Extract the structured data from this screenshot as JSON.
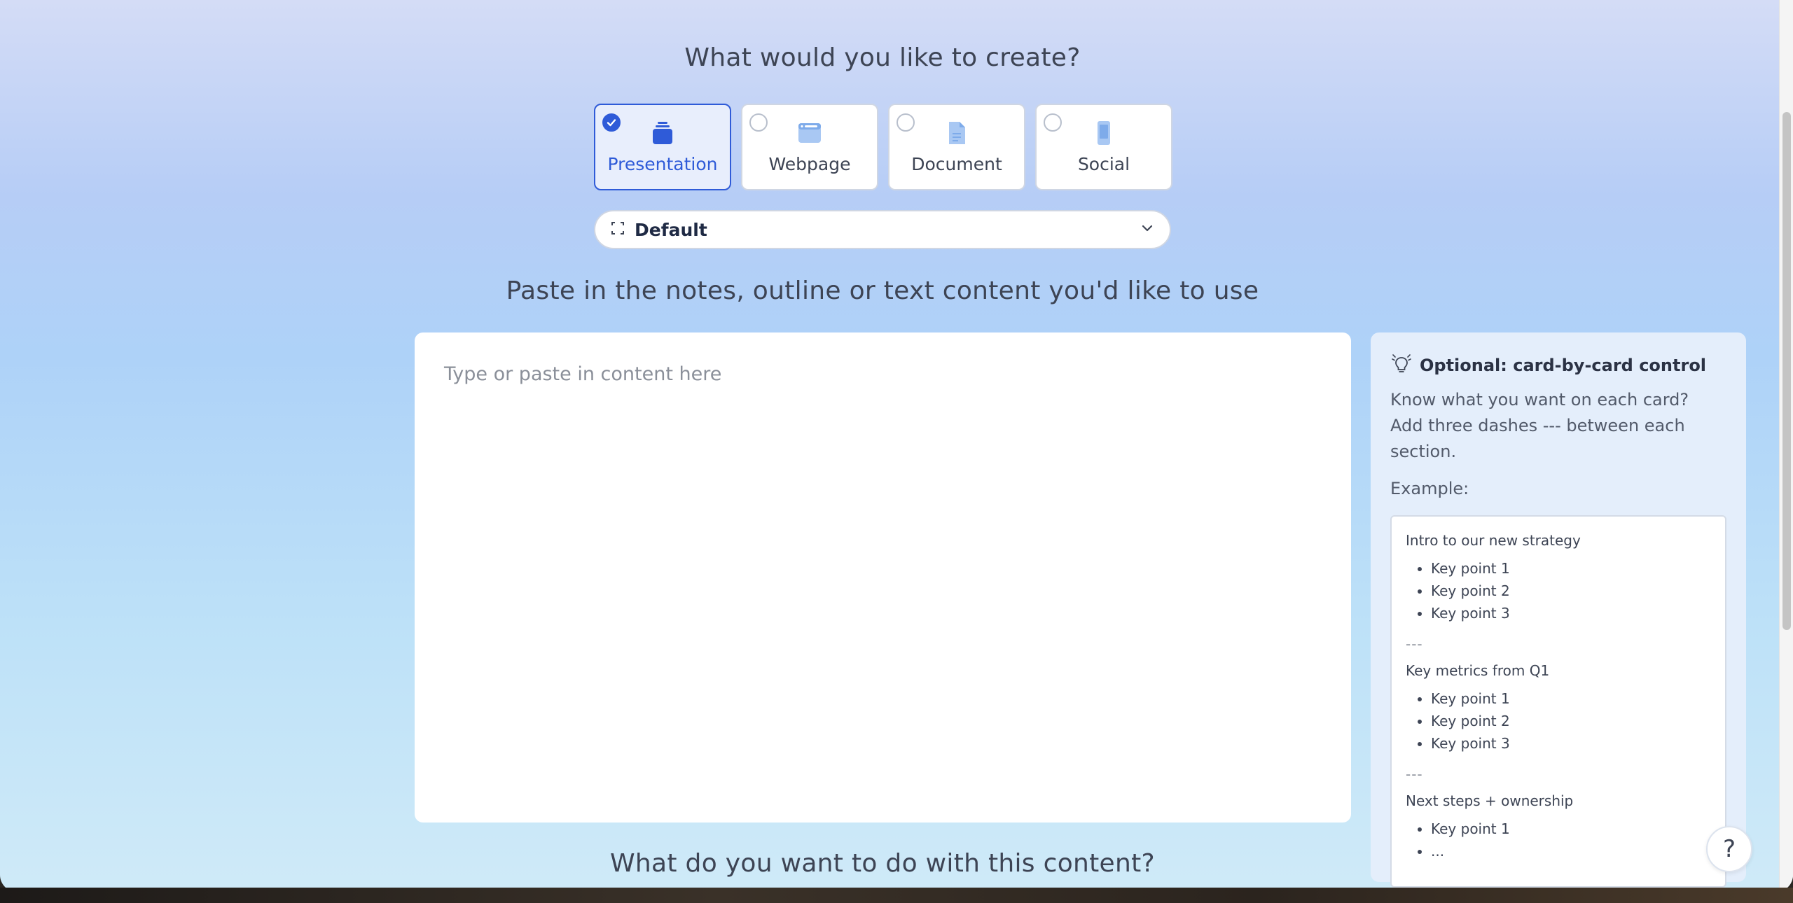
{
  "header": {
    "title": "What would you like to create?"
  },
  "types": [
    {
      "label": "Presentation",
      "selected": true,
      "icon": "stack-cards-icon"
    },
    {
      "label": "Webpage",
      "selected": false,
      "icon": "browser-window-icon"
    },
    {
      "label": "Document",
      "selected": false,
      "icon": "document-icon"
    },
    {
      "label": "Social",
      "selected": false,
      "icon": "phone-icon"
    }
  ],
  "theme": {
    "label": "Default",
    "icon": "aspect-ratio-icon"
  },
  "content": {
    "title": "Paste in the notes, outline or text content you'd like to use",
    "placeholder": "Type or paste in content here",
    "value": ""
  },
  "tip": {
    "title": "Optional: card-by-card control",
    "description": "Know what you want on each card? Add three dashes --- between each section.",
    "example_label": "Example:",
    "example": {
      "section1_title": "Intro to our new strategy",
      "section1_points": [
        "Key point 1",
        "Key point 2",
        "Key point 3"
      ],
      "separator": "---",
      "section2_title": "Key metrics from Q1",
      "section2_points": [
        "Key point 1",
        "Key point 2",
        "Key point 3"
      ],
      "section3_title": "Next steps + ownership",
      "section3_points": [
        "Key point 1",
        "..."
      ]
    }
  },
  "next_section": {
    "title": "What do you want to do with this content?"
  },
  "help": {
    "label": "?"
  },
  "colors": {
    "accent": "#2f5bd8",
    "text": "#3d4454"
  }
}
